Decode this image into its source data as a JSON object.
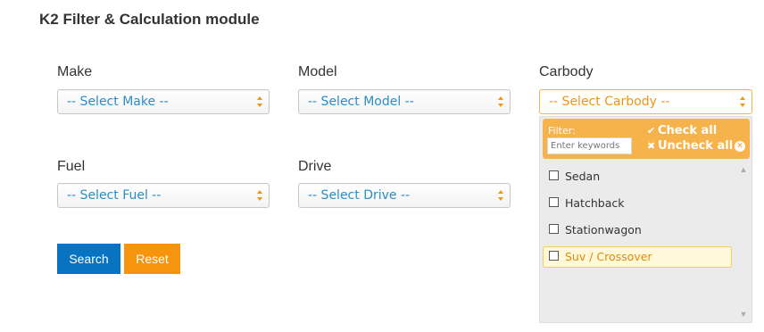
{
  "title": "K2 Filter & Calculation module",
  "fields": {
    "make": {
      "label": "Make",
      "value": "-- Select Make --"
    },
    "model": {
      "label": "Model",
      "value": "-- Select Model --"
    },
    "carbody": {
      "label": "Carbody",
      "value": "-- Select Carbody --"
    },
    "fuel": {
      "label": "Fuel",
      "value": "-- Select Fuel --"
    },
    "drive": {
      "label": "Drive",
      "value": "-- Select Drive --"
    }
  },
  "buttons": {
    "search": "Search",
    "reset": "Reset"
  },
  "dropdown": {
    "filter_label": "Filter:",
    "filter_placeholder": "Enter keywords",
    "check_all": "Check all",
    "uncheck_all": "Uncheck all",
    "options": [
      {
        "label": "Sedan",
        "checked": false
      },
      {
        "label": "Hatchback",
        "checked": false
      },
      {
        "label": "Stationwagon",
        "checked": false
      },
      {
        "label": "Suv / Crossover",
        "checked": false,
        "highlighted": true
      }
    ]
  },
  "colors": {
    "primary": "#0873c1",
    "accent": "#f7940e",
    "select_text": "#2a8dc8",
    "filter_bar": "#f6b24b"
  },
  "icons": {
    "select_arrows": "updown-arrows-icon",
    "check_all": "check-icon",
    "uncheck_all": "x-icon",
    "clear": "clear-circle-icon"
  }
}
